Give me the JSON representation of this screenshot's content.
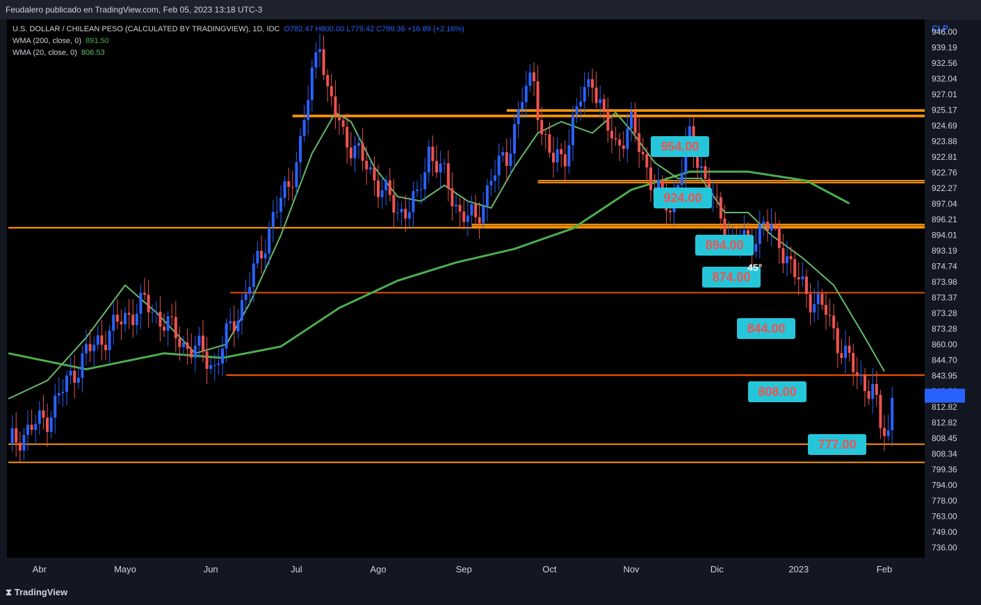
{
  "header": {
    "publish_line": "Feudalero publicado en TradingView.com, Feb 05, 2023 13:18 UTC-3"
  },
  "legend": {
    "symbol": "U.S. DOLLAR / CHILEAN PESO (CALCULATED BY TRADINGVIEW), 1D, IDC",
    "ohlc": "O782.47 H800.00 L779.42 C799.36 +16.89 (+2.16%)",
    "wma200_label": "WMA (200, close, 0)",
    "wma200_value": "891.50",
    "wma20_label": "WMA (20, close, 0)",
    "wma20_value": "806.53"
  },
  "currency": "CLP",
  "footer": {
    "brand": "TradingView"
  },
  "colors": {
    "up": "#2962ff",
    "down": "#ef5350",
    "wma200": "#4caf50",
    "wma20": "#66bb6a",
    "level_orange": "#ff9800",
    "level_red": "#e65100",
    "annotation": "#26c6da",
    "annotation_text": "#ef5350"
  },
  "chart_data": {
    "type": "candlestick",
    "ylim": [
      728,
      965
    ],
    "months": [
      {
        "label": "Abr",
        "i": 8
      },
      {
        "label": "Mayo",
        "i": 30
      },
      {
        "label": "Jun",
        "i": 52
      },
      {
        "label": "Jul",
        "i": 74
      },
      {
        "label": "Ago",
        "i": 95
      },
      {
        "label": "Sep",
        "i": 117
      },
      {
        "label": "Oct",
        "i": 139
      },
      {
        "label": "Nov",
        "i": 160
      },
      {
        "label": "Dic",
        "i": 182
      },
      {
        "label": "2023",
        "i": 203
      },
      {
        "label": "Feb",
        "i": 225
      }
    ],
    "close_path": [
      [
        0,
        778
      ],
      [
        5,
        784
      ],
      [
        10,
        790
      ],
      [
        15,
        805
      ],
      [
        20,
        818
      ],
      [
        25,
        826
      ],
      [
        30,
        834
      ],
      [
        35,
        840
      ],
      [
        40,
        832
      ],
      [
        45,
        822
      ],
      [
        50,
        818
      ],
      [
        53,
        812
      ],
      [
        56,
        825
      ],
      [
        60,
        840
      ],
      [
        64,
        858
      ],
      [
        68,
        878
      ],
      [
        72,
        892
      ],
      [
        75,
        910
      ],
      [
        78,
        940
      ],
      [
        80,
        958
      ],
      [
        82,
        932
      ],
      [
        86,
        915
      ],
      [
        90,
        905
      ],
      [
        95,
        893
      ],
      [
        100,
        880
      ],
      [
        105,
        885
      ],
      [
        108,
        908
      ],
      [
        112,
        895
      ],
      [
        116,
        880
      ],
      [
        120,
        876
      ],
      [
        124,
        895
      ],
      [
        128,
        905
      ],
      [
        132,
        930
      ],
      [
        135,
        940
      ],
      [
        137,
        915
      ],
      [
        140,
        902
      ],
      [
        143,
        907
      ],
      [
        147,
        930
      ],
      [
        150,
        940
      ],
      [
        153,
        920
      ],
      [
        156,
        910
      ],
      [
        160,
        918
      ],
      [
        163,
        905
      ],
      [
        166,
        890
      ],
      [
        170,
        882
      ],
      [
        172,
        895
      ],
      [
        175,
        912
      ],
      [
        178,
        900
      ],
      [
        182,
        880
      ],
      [
        186,
        868
      ],
      [
        190,
        866
      ],
      [
        194,
        875
      ],
      [
        198,
        868
      ],
      [
        202,
        852
      ],
      [
        206,
        843
      ],
      [
        210,
        836
      ],
      [
        214,
        820
      ],
      [
        218,
        808
      ],
      [
        222,
        802
      ],
      [
        224,
        785
      ],
      [
        226,
        783
      ],
      [
        227,
        799.36
      ]
    ],
    "wma200_path": [
      [
        0,
        818
      ],
      [
        20,
        811
      ],
      [
        40,
        818
      ],
      [
        55,
        816
      ],
      [
        70,
        821
      ],
      [
        85,
        838
      ],
      [
        100,
        850
      ],
      [
        115,
        858
      ],
      [
        130,
        864
      ],
      [
        145,
        873
      ],
      [
        160,
        890
      ],
      [
        175,
        898
      ],
      [
        190,
        898
      ],
      [
        205,
        894
      ],
      [
        216,
        884
      ]
    ],
    "wma20_path": [
      [
        0,
        798
      ],
      [
        10,
        806
      ],
      [
        20,
        825
      ],
      [
        30,
        848
      ],
      [
        38,
        836
      ],
      [
        48,
        818
      ],
      [
        56,
        822
      ],
      [
        62,
        840
      ],
      [
        70,
        870
      ],
      [
        78,
        906
      ],
      [
        84,
        924
      ],
      [
        88,
        920
      ],
      [
        94,
        900
      ],
      [
        100,
        887
      ],
      [
        106,
        885
      ],
      [
        112,
        892
      ],
      [
        118,
        885
      ],
      [
        124,
        882
      ],
      [
        130,
        900
      ],
      [
        136,
        915
      ],
      [
        142,
        920
      ],
      [
        150,
        915
      ],
      [
        156,
        924
      ],
      [
        160,
        916
      ],
      [
        166,
        902
      ],
      [
        172,
        895
      ],
      [
        178,
        895
      ],
      [
        184,
        880
      ],
      [
        190,
        880
      ],
      [
        196,
        870
      ],
      [
        204,
        860
      ],
      [
        212,
        848
      ],
      [
        220,
        825
      ],
      [
        225,
        810
      ]
    ],
    "levels": [
      {
        "y": 873.28,
        "c": "#ff9800",
        "x0": 0
      },
      {
        "y": 873.28,
        "c": "#ff9800",
        "x0": 0
      },
      {
        "y": 778.0,
        "c": "#ff9800",
        "x0": 0
      },
      {
        "y": 770.0,
        "c": "#ff9800",
        "x0": 0
      },
      {
        "y": 844.7,
        "c": "#e65100",
        "x0": 57
      },
      {
        "y": 808.45,
        "c": "#e65100",
        "x0": 56
      },
      {
        "y": 808.34,
        "c": "#e65100",
        "x0": 56
      },
      {
        "y": 922.76,
        "c": "#ff9800",
        "x0": 73
      },
      {
        "y": 922.27,
        "c": "#ff9800",
        "x0": 73
      },
      {
        "y": 925.17,
        "c": "#ff9800",
        "x0": 128
      },
      {
        "y": 924.69,
        "c": "#ff9800",
        "x0": 128
      },
      {
        "y": 894.01,
        "c": "#ff9800",
        "x0": 136
      },
      {
        "y": 893.19,
        "c": "#ff9800",
        "x0": 136
      },
      {
        "y": 874.74,
        "c": "#ff9800",
        "x0": 119
      },
      {
        "y": 873.98,
        "c": "#ff9800",
        "x0": 119
      }
    ],
    "annotations": [
      "954.00",
      "924.00",
      "894.00",
      "874.00",
      "844.00",
      "808.00",
      "777.00"
    ],
    "angle_label": "45°",
    "y_ticks": [
      "946.00",
      "939.19",
      "932.56",
      "932.04",
      "927.01",
      "925.17",
      "924.69",
      "923.88",
      "922.81",
      "922.76",
      "922.27",
      "897.04",
      "896.21",
      "894.01",
      "893.19",
      "874.74",
      "873.98",
      "873.37",
      "873.28",
      "873.28",
      "860.00",
      "844.70",
      "843.95",
      "840.00",
      "812.82",
      "812.82",
      "808.45",
      "808.34",
      "799.36",
      "794.00",
      "778.00",
      "763.00",
      "749.00",
      "736.00"
    ]
  }
}
